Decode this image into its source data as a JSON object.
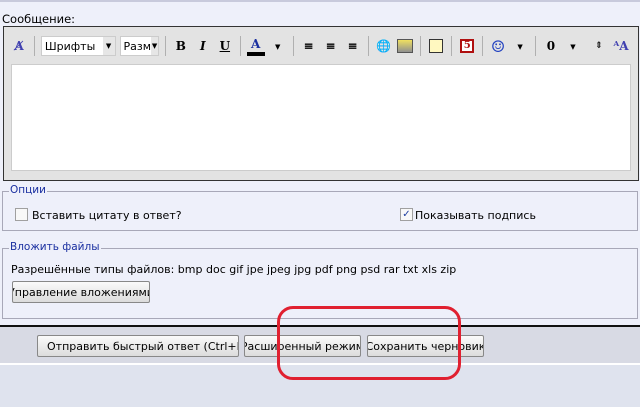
{
  "message_label": "Сообщение:",
  "toolbar": {
    "font_select": "Шрифты",
    "size_select": "Разм",
    "bold": "B",
    "italic": "I",
    "underline": "U",
    "color": "A",
    "attach": "0"
  },
  "options": {
    "legend": "Опции",
    "quote_label": "Вставить цитату в ответ?",
    "quote_checked": false,
    "signature_label": "Показывать подпись",
    "signature_checked": true
  },
  "attachments": {
    "legend": "Вложить файлы",
    "allowed_types": "Разрешённые типы файлов: bmp doc gif jpe jpeg jpg pdf png psd rar txt xls zip",
    "manage_button": "Управление вложениями"
  },
  "footer": {
    "submit_button": "Отправить быстрый ответ (Ctrl+Enter)",
    "advanced_button": "Расширенный режим",
    "draft_button": "Сохранить черновик"
  },
  "colors": {
    "annotation": "#e02030",
    "legend": "#1a2fa0"
  }
}
